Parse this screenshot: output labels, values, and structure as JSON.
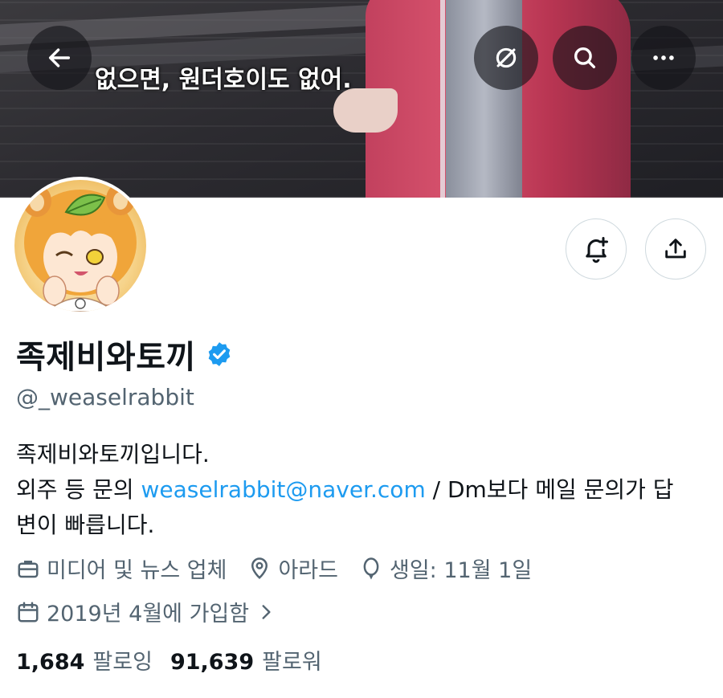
{
  "banner": {
    "caption": "없으면, 원더호이도 없어.",
    "back_icon": "arrow-left-icon",
    "mute_icon": "circle-slash-icon",
    "search_icon": "search-icon",
    "more_icon": "more-horizontal-icon"
  },
  "profile": {
    "display_name": "족제비와토끼",
    "verified": true,
    "verified_color": "#1d9bf0",
    "handle": "@_weaselrabbit",
    "bio_line1": "족제비와토끼입니다.",
    "bio_line2_prefix": "외주 등 문의 ",
    "bio_email": "weaselrabbit@naver.com",
    "bio_line2_suffix": " / Dm보다 메일 문의가 답",
    "bio_line3": "변이 빠릅니다.",
    "category": "미디어 및 뉴스 업체",
    "location": "아라드",
    "birthday": "생일: 11월 1일",
    "joined": "2019년 4월에 가입함",
    "following_count": "1,684",
    "following_label": "팔로잉",
    "followers_count": "91,639",
    "followers_label": "팔로워"
  },
  "actions": {
    "notify_icon": "bell-plus-icon",
    "share_icon": "share-upload-icon"
  },
  "colors": {
    "link": "#1d9bf0",
    "secondary_text": "#536471",
    "border": "#cfd9de"
  }
}
